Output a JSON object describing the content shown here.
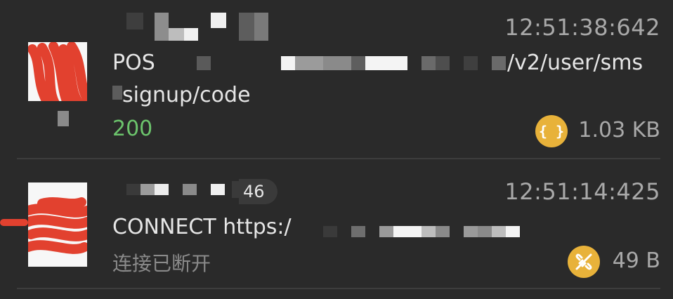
{
  "colors": {
    "background": "#2a2a2a",
    "status_success": "#6cc46c",
    "status_info": "#8a8a8a",
    "badge": "#e8b23a"
  },
  "requests": [
    {
      "time": "12:51:38:642",
      "url_line1_prefix": "POS",
      "url_line1_suffix": "/v2/user/sms",
      "url_line2": "signup/code",
      "status": "200",
      "type_icon": "json-braces-icon",
      "size": "1.03 KB"
    },
    {
      "count": "46",
      "time": "12:51:14:425",
      "method_url": "CONNECT https:/",
      "status": "连接已断开",
      "type_icon": "broken-link-icon",
      "size": "49 B"
    }
  ]
}
